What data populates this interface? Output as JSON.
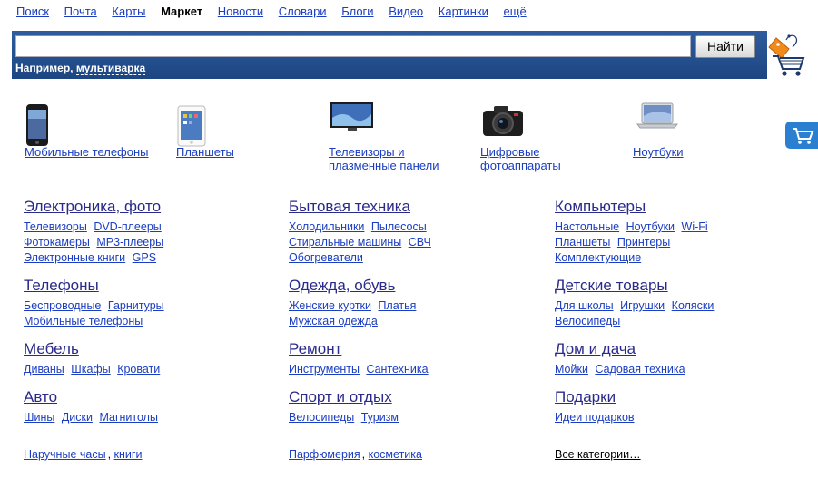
{
  "nav": {
    "items": [
      {
        "label": "Поиск",
        "active": false
      },
      {
        "label": "Почта",
        "active": false
      },
      {
        "label": "Карты",
        "active": false
      },
      {
        "label": "Маркет",
        "active": true
      },
      {
        "label": "Новости",
        "active": false
      },
      {
        "label": "Словари",
        "active": false
      },
      {
        "label": "Блоги",
        "active": false
      },
      {
        "label": "Видео",
        "active": false
      },
      {
        "label": "Картинки",
        "active": false
      },
      {
        "label": "ещё",
        "active": false
      }
    ]
  },
  "search": {
    "value": "",
    "placeholder": "",
    "button_label": "Найти",
    "hint_prefix": "Например,",
    "hint_example": "мультиварка"
  },
  "featured": [
    {
      "label": "Мобильные телефоны",
      "icon": "phone-icon"
    },
    {
      "label": "Планшеты",
      "icon": "tablet-icon"
    },
    {
      "label": "Телевизоры и плазменные панели",
      "icon": "tv-icon"
    },
    {
      "label": "Цифровые фотоаппараты",
      "icon": "camera-icon"
    },
    {
      "label": "Ноутбуки",
      "icon": "laptop-icon"
    }
  ],
  "categories": {
    "col1": [
      {
        "title": "Электроника, фото",
        "lines": [
          [
            "Телевизоры",
            "DVD-плееры"
          ],
          [
            "Фотокамеры",
            "MP3-плееры"
          ],
          [
            "Электронные книги",
            "GPS"
          ]
        ]
      },
      {
        "title": "Телефоны",
        "lines": [
          [
            "Беспроводные",
            "Гарнитуры"
          ],
          [
            "Мобильные телефоны"
          ]
        ]
      },
      {
        "title": "Мебель",
        "lines": [
          [
            "Диваны",
            "Шкафы",
            "Кровати"
          ]
        ]
      },
      {
        "title": "Авто",
        "lines": [
          [
            "Шины",
            "Диски",
            "Магнитолы"
          ]
        ]
      }
    ],
    "col2": [
      {
        "title": "Бытовая техника",
        "lines": [
          [
            "Холодильники",
            "Пылесосы"
          ],
          [
            "Стиральные машины",
            "СВЧ"
          ],
          [
            "Обогреватели"
          ]
        ]
      },
      {
        "title": "Одежда, обувь",
        "lines": [
          [
            "Женские куртки",
            "Платья"
          ],
          [
            "Мужская одежда"
          ]
        ]
      },
      {
        "title": "Ремонт",
        "lines": [
          [
            "Инструменты",
            "Сантехника"
          ]
        ]
      },
      {
        "title": "Спорт и отдых",
        "lines": [
          [
            "Велосипеды",
            "Туризм"
          ]
        ]
      }
    ],
    "col3": [
      {
        "title": "Компьютеры",
        "lines": [
          [
            "Настольные",
            "Ноутбуки",
            "Wi-Fi"
          ],
          [
            "Планшеты",
            "Принтеры"
          ],
          [
            "Комплектующие"
          ]
        ]
      },
      {
        "title": "Детские товары",
        "lines": [
          [
            "Для школы",
            "Игрушки",
            "Коляски"
          ],
          [
            "Велосипеды"
          ]
        ]
      },
      {
        "title": "Дом и дача",
        "lines": [
          [
            "Мойки",
            "Садовая техника"
          ]
        ]
      },
      {
        "title": "Подарки",
        "lines": [
          [
            "Идеи подарков"
          ]
        ]
      }
    ]
  },
  "bottom": {
    "col1": [
      "Наручные часы",
      "книги"
    ],
    "col2": [
      "Парфюмерия",
      "косметика"
    ],
    "all_categories": "Все категории…"
  },
  "colors": {
    "link": "#1a3dc1",
    "search_bar": "#25508f",
    "category_title": "#2a2a8a"
  }
}
